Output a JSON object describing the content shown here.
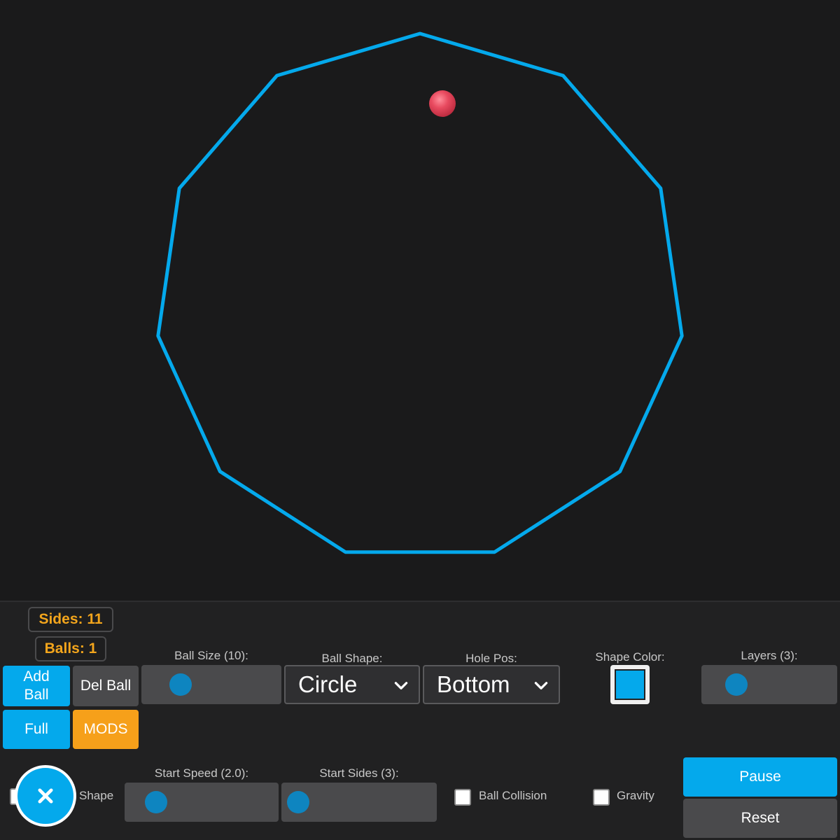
{
  "colors": {
    "background": "#1a1a1b",
    "shape_color": "#04a9ec",
    "ball_color": "#e84a5f",
    "accent_orange": "#f3a51c"
  },
  "game": {
    "shape_sides": 11,
    "ball_count": 1
  },
  "stats": {
    "sides_label": "Sides: 11",
    "balls_label": "Balls: 1"
  },
  "buttons": {
    "add_ball": "Add Ball",
    "del_ball": "Del Ball",
    "full": "Full",
    "mods": "MODS",
    "pause": "Pause",
    "reset": "Reset"
  },
  "controls": {
    "ball_size": {
      "label": "Ball Size (10):",
      "value": 10,
      "fraction": 0.21
    },
    "ball_shape": {
      "label": "Ball Shape:",
      "selected": "Circle"
    },
    "hole_pos": {
      "label": "Hole Pos:",
      "selected": "Bottom"
    },
    "shape_color": {
      "label": "Shape Color:",
      "value": "#04a9ec"
    },
    "layers": {
      "label": "Layers (3):",
      "value": 3,
      "fraction": 0.18
    },
    "grow_shape": {
      "label_visible": "w Shape",
      "checked": false
    },
    "start_speed": {
      "label": "Start Speed (2.0):",
      "value": 2.0,
      "fraction": 0.12
    },
    "start_sides": {
      "label": "Start Sides (3):",
      "value": 3,
      "fraction": 0.0
    },
    "ball_collision": {
      "label": "Ball Collision",
      "checked": false
    },
    "gravity": {
      "label": "Gravity",
      "checked": false
    }
  },
  "icons": {
    "close": "close-icon",
    "dropdown": "chevron-down-icon"
  }
}
